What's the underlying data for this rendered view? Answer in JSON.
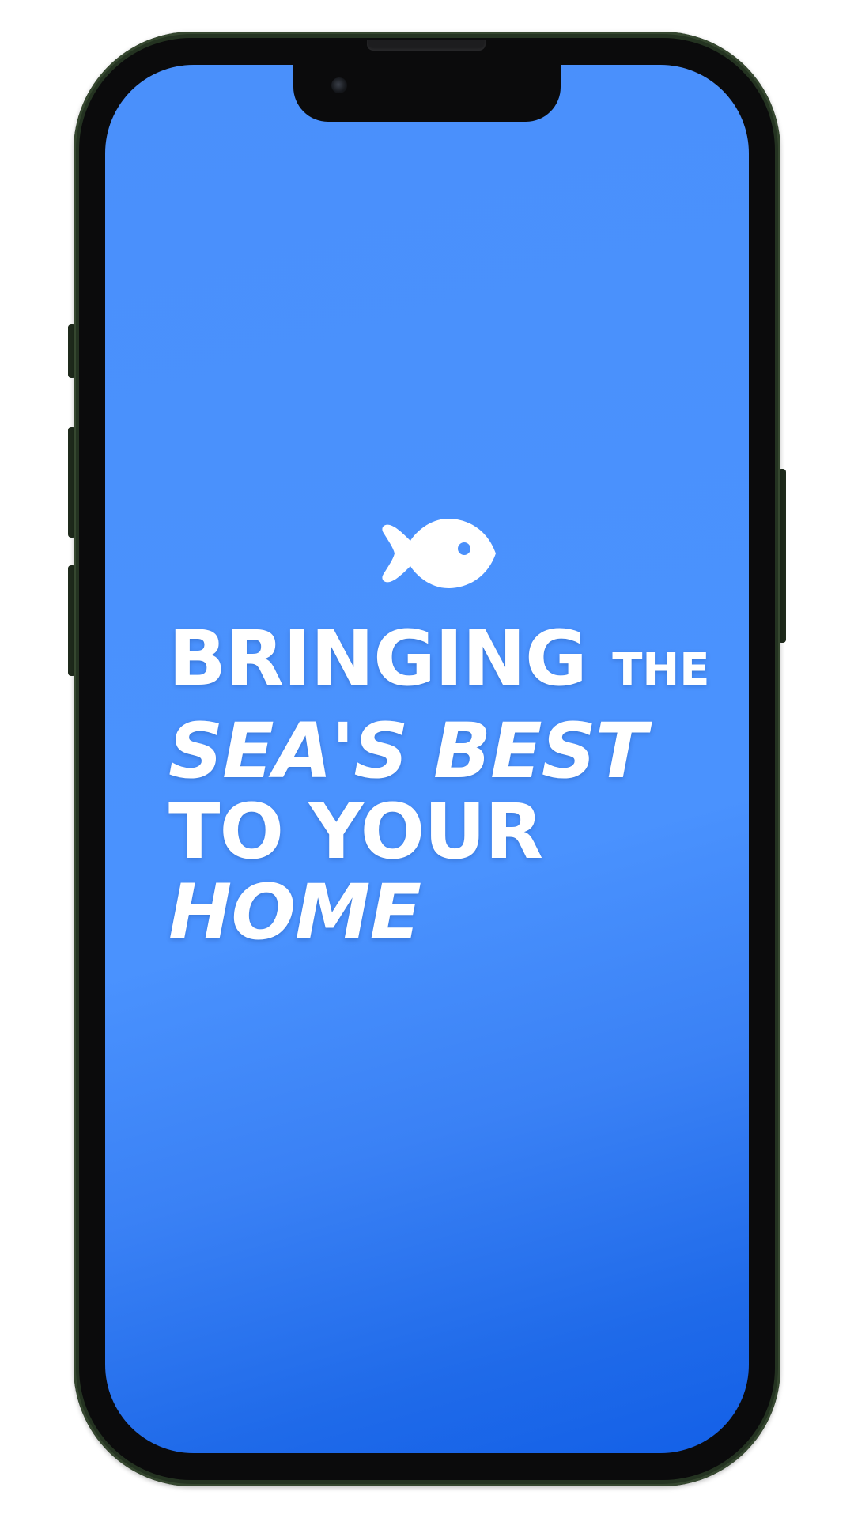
{
  "colors": {
    "screen_top": "#4a90fb",
    "screen_bottom": "#1360e8",
    "text": "#ffffff",
    "phone_frame": "#243321"
  },
  "splash": {
    "icon": "fish-icon",
    "tagline": {
      "line1_big": "BRINGING",
      "line1_small": "THE",
      "line2": "SEA'S BEST",
      "line3": "TO YOUR",
      "line4": "HOME"
    }
  }
}
